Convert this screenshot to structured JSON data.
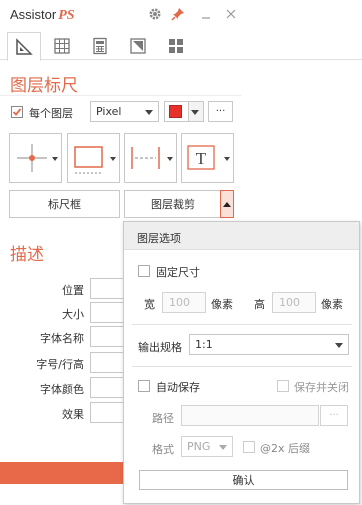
{
  "app": {
    "title": "Assistor",
    "title_suffix": "PS"
  },
  "window_controls": [
    "gear-icon",
    "pin-icon",
    "minimize-icon",
    "close-icon"
  ],
  "tabs": [
    "ruler-tab",
    "grid-tab",
    "calculator-tab",
    "slice-tab",
    "layout-tab"
  ],
  "ruler_section": {
    "title": "图层标尺",
    "each_layer_label": "每个图层",
    "each_layer_checked": true,
    "unit_select": "Pixel",
    "color": "#e8302a",
    "more_button": "···",
    "ruler_frame_button": "标尺框",
    "layer_crop_button": "图层裁剪"
  },
  "describe_section": {
    "title": "描述",
    "fields": [
      "位置",
      "大小",
      "字体名称",
      "字号/行高",
      "字体颜色",
      "效果"
    ]
  },
  "popup": {
    "title": "图层选项",
    "fixed_size_label": "固定尺寸",
    "width_label": "宽",
    "width_value": "100",
    "height_label": "高",
    "height_value": "100",
    "px_unit": "像素",
    "output_spec_label": "输出规格",
    "output_spec_value": "1:1",
    "autosave_label": "自动保存",
    "save_close_label": "保存并关闭",
    "path_label": "路径",
    "path_browse": "···",
    "format_label": "格式",
    "format_value": "PNG",
    "retina_label": "@2x 后缀",
    "confirm_label": "确认"
  },
  "colors": {
    "accent": "#e26a4b",
    "bottom_bar": "#e8694a"
  }
}
